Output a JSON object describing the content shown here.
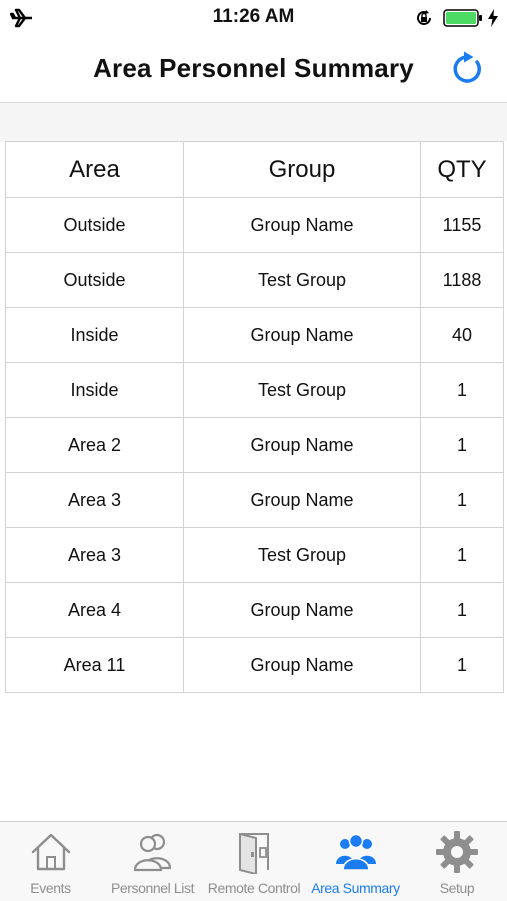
{
  "status": {
    "time": "11:26 AM"
  },
  "header": {
    "title": "Area Personnel Summary"
  },
  "table": {
    "headers": [
      "Area",
      "Group",
      "QTY"
    ],
    "rows": [
      [
        "Outside",
        "Group Name",
        "1155"
      ],
      [
        "Outside",
        "Test Group",
        "1188"
      ],
      [
        "Inside",
        "Group Name",
        "40"
      ],
      [
        "Inside",
        "Test Group",
        "1"
      ],
      [
        "Area 2",
        "Group Name",
        "1"
      ],
      [
        "Area 3",
        "Group Name",
        "1"
      ],
      [
        "Area 3",
        "Test Group",
        "1"
      ],
      [
        "Area 4",
        "Group Name",
        "1"
      ],
      [
        "Area 11",
        "Group Name",
        "1"
      ]
    ]
  },
  "tabs": [
    {
      "label": "Events",
      "icon": "home-icon"
    },
    {
      "label": "Personnel List",
      "icon": "people-icon"
    },
    {
      "label": "Remote Control",
      "icon": "door-icon"
    },
    {
      "label": "Area Summary",
      "icon": "group-icon"
    },
    {
      "label": "Setup",
      "icon": "gear-icon"
    }
  ],
  "active_tab": "Area Summary",
  "colors": {
    "accent": "#1a7cf0",
    "inactive": "#8e8e8e",
    "battery": "#4cd964"
  }
}
